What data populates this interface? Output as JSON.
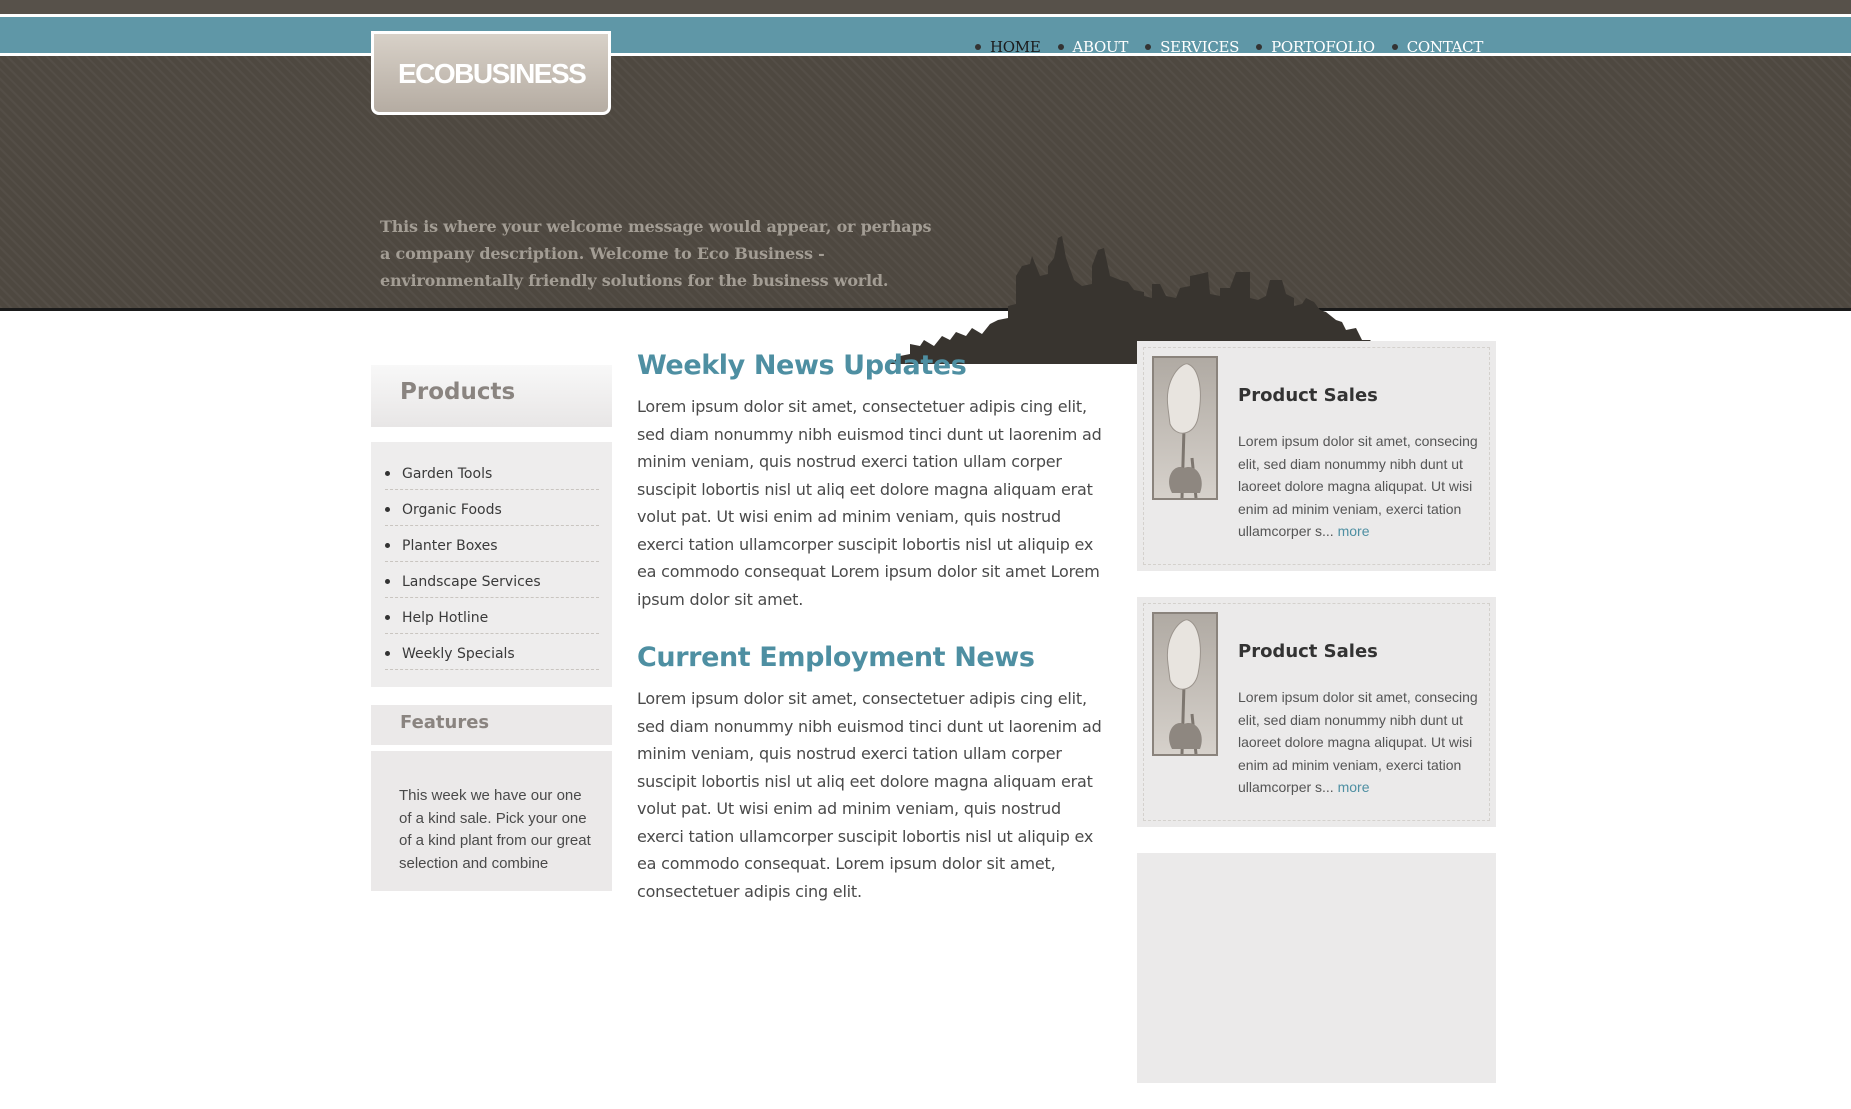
{
  "brand": {
    "logo": "ECOBUSINESS"
  },
  "nav": {
    "items": [
      {
        "label": "HOME",
        "active": true
      },
      {
        "label": "ABOUT"
      },
      {
        "label": "SERVICES"
      },
      {
        "label": "PORTOFOLIO"
      },
      {
        "label": "CONTACT"
      }
    ]
  },
  "header": {
    "welcome": "This is where your welcome message would appear, or perhaps a company description. Welcome to Eco Business - environmentally friendly solutions for the business world."
  },
  "sidebar": {
    "products_title": "Products",
    "products": [
      "Garden Tools",
      "Organic Foods",
      "Planter Boxes",
      "Landscape Services",
      "Help Hotline",
      "Weekly Specials"
    ],
    "features_title": "Features",
    "features_text": "This week we have our one of a kind sale. Pick your one of a kind plant from our great selection and combine"
  },
  "main": {
    "sections": [
      {
        "title": "Weekly News Updates",
        "body": "Lorem ipsum dolor sit amet, consectetuer adipis cing elit, sed diam nonummy nibh euismod tinci dunt ut laorenim ad minim veniam, quis nostrud exerci tation ullam corper suscipit lobortis nisl ut aliq eet dolore magna aliquam erat volut pat. Ut wisi enim ad minim veniam, quis nostrud exerci tation ullamcorper suscipit lobortis nisl ut aliquip ex ea commodo consequat Lorem ipsum dolor sit amet Lorem ipsum dolor sit amet."
      },
      {
        "title": "Current Employment News",
        "body": "Lorem ipsum dolor sit amet, consectetuer adipis cing elit, sed diam nonummy nibh euismod tinci dunt ut laorenim ad minim veniam, quis nostrud exerci tation ullam corper suscipit lobortis nisl ut aliq eet dolore magna aliquam erat volut pat. Ut wisi enim ad minim veniam, quis nostrud exerci tation ullamcorper suscipit lobortis nisl ut aliquip ex ea commodo consequat. Lorem ipsum dolor sit amet, consectetuer adipis cing elit."
      }
    ]
  },
  "cards": [
    {
      "title": "Product Sales",
      "text": "Lorem ipsum dolor sit amet, consecing elit, sed diam nonummy nibh dunt ut laoreet dolore magna aliqupat. Ut wisi enim ad minim veniam, exerci tation ullamcorper s...",
      "more": "more"
    },
    {
      "title": "Product Sales",
      "text": "Lorem ipsum dolor sit amet, consecing elit, sed diam nonummy nibh dunt ut laoreet dolore magna aliqupat. Ut wisi enim ad minim veniam, exerci tation ullamcorper s...",
      "more": "more"
    }
  ],
  "colors": {
    "accent": "#4e8fa2",
    "header_bg": "#4e4840",
    "nav_band": "#5f97a7"
  },
  "icons": [
    "skyline-graphic",
    "tulip-thumbnail"
  ]
}
